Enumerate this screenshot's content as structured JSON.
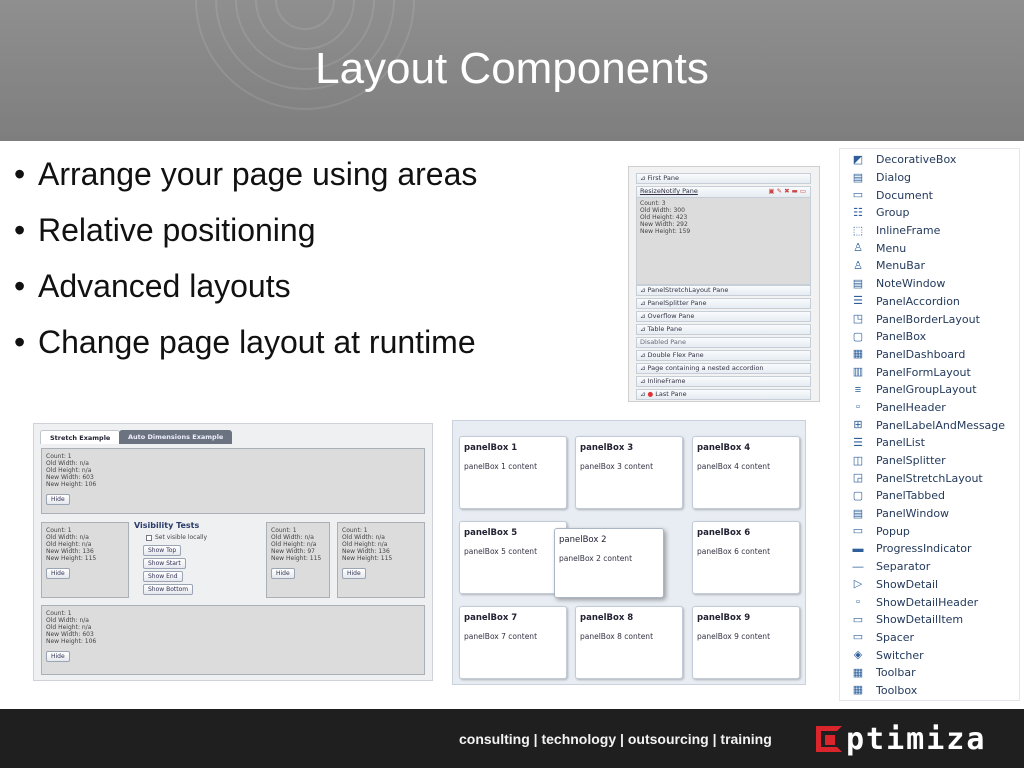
{
  "slide": {
    "title": "Layout Components",
    "bullets": [
      "Arrange your page using areas",
      "Relative positioning",
      "Advanced layouts",
      "Change page layout at runtime"
    ]
  },
  "accordion": {
    "first_pane": "First Pane",
    "resize_pane": "ResizeNotify Pane",
    "resize_info": [
      "Count: 3",
      "Old Width: 300",
      "Old Height: 423",
      "New Width: 292",
      "New Height: 159"
    ],
    "panes": [
      "PanelStretchLayout Pane",
      "PanelSplitter Pane",
      "Overflow Pane",
      "Table Pane",
      "Disabled Pane",
      "Double Flex Pane",
      "Page containing a nested accordion",
      "InlineFrame",
      "Last Pane"
    ]
  },
  "stretch_example": {
    "tabs": [
      "Stretch Example",
      "Auto Dimensions Example"
    ],
    "top_box": [
      "Count: 1",
      "Old Width: n/a",
      "Old Height: n/a",
      "New Width: 603",
      "New Height: 106"
    ],
    "left_box": [
      "Count: 1",
      "Old Width: n/a",
      "Old Height: n/a",
      "New Width: 136",
      "New Height: 115"
    ],
    "mid_box": [
      "Count: 1",
      "Old Width: n/a",
      "Old Height: n/a",
      "New Width: 97",
      "New Height: 115"
    ],
    "right_box": [
      "Count: 1",
      "Old Width: n/a",
      "Old Height: n/a",
      "New Width: 136",
      "New Height: 115"
    ],
    "bottom_box": [
      "Count: 1",
      "Old Width: n/a",
      "Old Height: n/a",
      "New Width: 603",
      "New Height: 106"
    ],
    "hide_label": "Hide",
    "visibility_title": "Visibility Tests",
    "set_visible_label": "Set visible locally",
    "buttons": [
      "Show Top",
      "Show Start",
      "Show End",
      "Show Bottom"
    ]
  },
  "panel_boxes": [
    {
      "title": "panelBox 1",
      "content": "panelBox 1 content"
    },
    {
      "title": "panelBox 3",
      "content": "panelBox 3 content"
    },
    {
      "title": "panelBox 4",
      "content": "panelBox 4 content"
    },
    {
      "title": "panelBox 5",
      "content": "panelBox 5 content"
    },
    {
      "title": "panelBox 2",
      "content": "panelBox 2 content"
    },
    {
      "title": "panelBox 6",
      "content": "panelBox 6 content"
    },
    {
      "title": "panelBox 7",
      "content": "panelBox 7 content"
    },
    {
      "title": "panelBox 8",
      "content": "panelBox 8 content"
    },
    {
      "title": "panelBox 9",
      "content": "panelBox 9 content"
    }
  ],
  "components": [
    {
      "label": "DecorativeBox",
      "icon": "decorativebox-icon",
      "glyph": "◩"
    },
    {
      "label": "Dialog",
      "icon": "dialog-icon",
      "glyph": "▤"
    },
    {
      "label": "Document",
      "icon": "document-icon",
      "glyph": "▭"
    },
    {
      "label": "Group",
      "icon": "group-icon",
      "glyph": "☷"
    },
    {
      "label": "InlineFrame",
      "icon": "inlineframe-icon",
      "glyph": "⬚"
    },
    {
      "label": "Menu",
      "icon": "menu-icon",
      "glyph": "♙"
    },
    {
      "label": "MenuBar",
      "icon": "menubar-icon",
      "glyph": "♙"
    },
    {
      "label": "NoteWindow",
      "icon": "notewindow-icon",
      "glyph": "▤"
    },
    {
      "label": "PanelAccordion",
      "icon": "panelaccordion-icon",
      "glyph": "☰"
    },
    {
      "label": "PanelBorderLayout",
      "icon": "panelborderlayout-icon",
      "glyph": "◳"
    },
    {
      "label": "PanelBox",
      "icon": "panelbox-icon",
      "glyph": "▢"
    },
    {
      "label": "PanelDashboard",
      "icon": "paneldashboard-icon",
      "glyph": "▦"
    },
    {
      "label": "PanelFormLayout",
      "icon": "panelformlayout-icon",
      "glyph": "▥"
    },
    {
      "label": "PanelGroupLayout",
      "icon": "panelgrouplayout-icon",
      "glyph": "≡"
    },
    {
      "label": "PanelHeader",
      "icon": "panelheader-icon",
      "glyph": "▫"
    },
    {
      "label": "PanelLabelAndMessage",
      "icon": "panellabelandmessage-icon",
      "glyph": "⊞"
    },
    {
      "label": "PanelList",
      "icon": "panellist-icon",
      "glyph": "☰"
    },
    {
      "label": "PanelSplitter",
      "icon": "panelsplitter-icon",
      "glyph": "◫"
    },
    {
      "label": "PanelStretchLayout",
      "icon": "panelstretchlayout-icon",
      "glyph": "◲"
    },
    {
      "label": "PanelTabbed",
      "icon": "paneltabbed-icon",
      "glyph": "▢"
    },
    {
      "label": "PanelWindow",
      "icon": "panelwindow-icon",
      "glyph": "▤"
    },
    {
      "label": "Popup",
      "icon": "popup-icon",
      "glyph": "▭"
    },
    {
      "label": "ProgressIndicator",
      "icon": "progressindicator-icon",
      "glyph": "▬"
    },
    {
      "label": "Separator",
      "icon": "separator-icon",
      "glyph": "—"
    },
    {
      "label": "ShowDetail",
      "icon": "showdetail-icon",
      "glyph": "▷"
    },
    {
      "label": "ShowDetailHeader",
      "icon": "showdetailheader-icon",
      "glyph": "▫"
    },
    {
      "label": "ShowDetailItem",
      "icon": "showdetailitem-icon",
      "glyph": "▭"
    },
    {
      "label": "Spacer",
      "icon": "spacer-icon",
      "glyph": "▭"
    },
    {
      "label": "Switcher",
      "icon": "switcher-icon",
      "glyph": "◈"
    },
    {
      "label": "Toolbar",
      "icon": "toolbar-icon",
      "glyph": "▦"
    },
    {
      "label": "Toolbox",
      "icon": "toolbox-icon",
      "glyph": "▦"
    }
  ],
  "footer": {
    "tagline": "consulting | technology | outsourcing | training",
    "logo_text": "ptimiza"
  },
  "colors": {
    "header_gray": "#8a8a8a",
    "footer_black": "#1f1f1f",
    "logo_red": "#d9252b",
    "link_blue": "#233a5c"
  }
}
